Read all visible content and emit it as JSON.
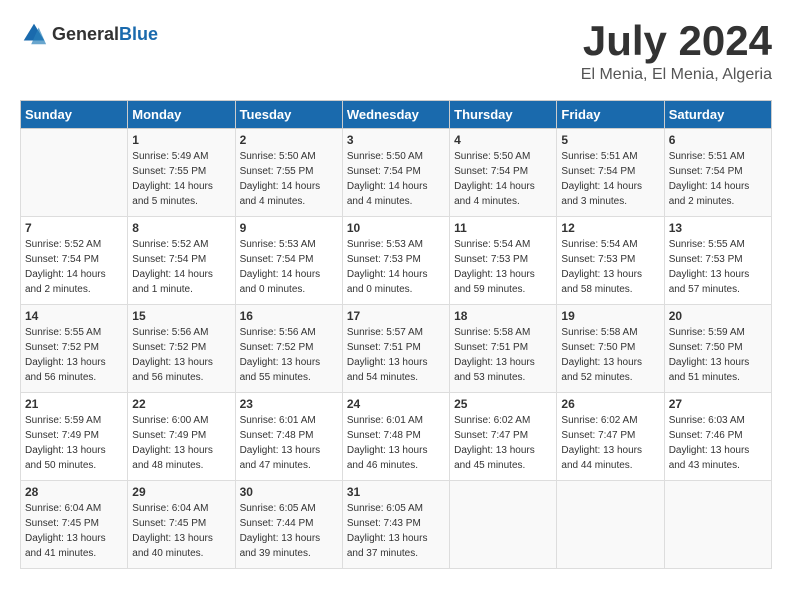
{
  "header": {
    "logo_general": "General",
    "logo_blue": "Blue",
    "month_year": "July 2024",
    "location": "El Menia, El Menia, Algeria"
  },
  "days_of_week": [
    "Sunday",
    "Monday",
    "Tuesday",
    "Wednesday",
    "Thursday",
    "Friday",
    "Saturday"
  ],
  "weeks": [
    [
      {
        "day": "",
        "info": ""
      },
      {
        "day": "1",
        "info": "Sunrise: 5:49 AM\nSunset: 7:55 PM\nDaylight: 14 hours\nand 5 minutes."
      },
      {
        "day": "2",
        "info": "Sunrise: 5:50 AM\nSunset: 7:55 PM\nDaylight: 14 hours\nand 4 minutes."
      },
      {
        "day": "3",
        "info": "Sunrise: 5:50 AM\nSunset: 7:54 PM\nDaylight: 14 hours\nand 4 minutes."
      },
      {
        "day": "4",
        "info": "Sunrise: 5:50 AM\nSunset: 7:54 PM\nDaylight: 14 hours\nand 4 minutes."
      },
      {
        "day": "5",
        "info": "Sunrise: 5:51 AM\nSunset: 7:54 PM\nDaylight: 14 hours\nand 3 minutes."
      },
      {
        "day": "6",
        "info": "Sunrise: 5:51 AM\nSunset: 7:54 PM\nDaylight: 14 hours\nand 2 minutes."
      }
    ],
    [
      {
        "day": "7",
        "info": "Sunrise: 5:52 AM\nSunset: 7:54 PM\nDaylight: 14 hours\nand 2 minutes."
      },
      {
        "day": "8",
        "info": "Sunrise: 5:52 AM\nSunset: 7:54 PM\nDaylight: 14 hours\nand 1 minute."
      },
      {
        "day": "9",
        "info": "Sunrise: 5:53 AM\nSunset: 7:54 PM\nDaylight: 14 hours\nand 0 minutes."
      },
      {
        "day": "10",
        "info": "Sunrise: 5:53 AM\nSunset: 7:53 PM\nDaylight: 14 hours\nand 0 minutes."
      },
      {
        "day": "11",
        "info": "Sunrise: 5:54 AM\nSunset: 7:53 PM\nDaylight: 13 hours\nand 59 minutes."
      },
      {
        "day": "12",
        "info": "Sunrise: 5:54 AM\nSunset: 7:53 PM\nDaylight: 13 hours\nand 58 minutes."
      },
      {
        "day": "13",
        "info": "Sunrise: 5:55 AM\nSunset: 7:53 PM\nDaylight: 13 hours\nand 57 minutes."
      }
    ],
    [
      {
        "day": "14",
        "info": "Sunrise: 5:55 AM\nSunset: 7:52 PM\nDaylight: 13 hours\nand 56 minutes."
      },
      {
        "day": "15",
        "info": "Sunrise: 5:56 AM\nSunset: 7:52 PM\nDaylight: 13 hours\nand 56 minutes."
      },
      {
        "day": "16",
        "info": "Sunrise: 5:56 AM\nSunset: 7:52 PM\nDaylight: 13 hours\nand 55 minutes."
      },
      {
        "day": "17",
        "info": "Sunrise: 5:57 AM\nSunset: 7:51 PM\nDaylight: 13 hours\nand 54 minutes."
      },
      {
        "day": "18",
        "info": "Sunrise: 5:58 AM\nSunset: 7:51 PM\nDaylight: 13 hours\nand 53 minutes."
      },
      {
        "day": "19",
        "info": "Sunrise: 5:58 AM\nSunset: 7:50 PM\nDaylight: 13 hours\nand 52 minutes."
      },
      {
        "day": "20",
        "info": "Sunrise: 5:59 AM\nSunset: 7:50 PM\nDaylight: 13 hours\nand 51 minutes."
      }
    ],
    [
      {
        "day": "21",
        "info": "Sunrise: 5:59 AM\nSunset: 7:49 PM\nDaylight: 13 hours\nand 50 minutes."
      },
      {
        "day": "22",
        "info": "Sunrise: 6:00 AM\nSunset: 7:49 PM\nDaylight: 13 hours\nand 48 minutes."
      },
      {
        "day": "23",
        "info": "Sunrise: 6:01 AM\nSunset: 7:48 PM\nDaylight: 13 hours\nand 47 minutes."
      },
      {
        "day": "24",
        "info": "Sunrise: 6:01 AM\nSunset: 7:48 PM\nDaylight: 13 hours\nand 46 minutes."
      },
      {
        "day": "25",
        "info": "Sunrise: 6:02 AM\nSunset: 7:47 PM\nDaylight: 13 hours\nand 45 minutes."
      },
      {
        "day": "26",
        "info": "Sunrise: 6:02 AM\nSunset: 7:47 PM\nDaylight: 13 hours\nand 44 minutes."
      },
      {
        "day": "27",
        "info": "Sunrise: 6:03 AM\nSunset: 7:46 PM\nDaylight: 13 hours\nand 43 minutes."
      }
    ],
    [
      {
        "day": "28",
        "info": "Sunrise: 6:04 AM\nSunset: 7:45 PM\nDaylight: 13 hours\nand 41 minutes."
      },
      {
        "day": "29",
        "info": "Sunrise: 6:04 AM\nSunset: 7:45 PM\nDaylight: 13 hours\nand 40 minutes."
      },
      {
        "day": "30",
        "info": "Sunrise: 6:05 AM\nSunset: 7:44 PM\nDaylight: 13 hours\nand 39 minutes."
      },
      {
        "day": "31",
        "info": "Sunrise: 6:05 AM\nSunset: 7:43 PM\nDaylight: 13 hours\nand 37 minutes."
      },
      {
        "day": "",
        "info": ""
      },
      {
        "day": "",
        "info": ""
      },
      {
        "day": "",
        "info": ""
      }
    ]
  ]
}
